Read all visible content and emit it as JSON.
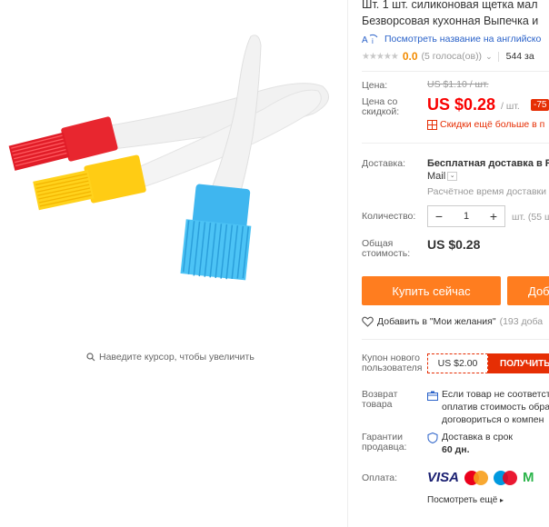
{
  "gallery": {
    "zoom_hint": "Наведите курсор, чтобы увеличить"
  },
  "product": {
    "title_line1": "Шт. 1 шт. силиконовая щетка мал",
    "title_line2": "Безворсовая кухонная Выпечка и",
    "translate_link": "Посмотреть название на английско",
    "rating_value": "0.0",
    "votes": "(5 голоса(ов))",
    "orders": "544 за"
  },
  "price": {
    "label_price": "Цена:",
    "old_price": "US $1.10 / шт.",
    "label_discount_line1": "Цена со",
    "label_discount_line2": "скидкой:",
    "sale_price": "US $0.28",
    "unit": "/ шт.",
    "discount_badge": "-75",
    "promo_text": "Скидки ещё больше в п"
  },
  "shipping": {
    "label": "Доставка:",
    "text_bold": "Бесплатная доставка в Ru",
    "method": "Mail",
    "estimate": "Расчётное время доставки"
  },
  "quantity": {
    "label": "Количество:",
    "value": "1",
    "minus": "−",
    "plus": "+",
    "available": "шт. (55 ш"
  },
  "total": {
    "label_line1": "Общая",
    "label_line2": "стоимость:",
    "value": "US $0.28"
  },
  "actions": {
    "buy_now": "Купить сейчас",
    "add_to_cart": "Доб"
  },
  "wishlist": {
    "label": "Добавить в \"Мои желания\"",
    "count": "(193 доба"
  },
  "coupon": {
    "label_line1": "Купон нового",
    "label_line2": "пользователя",
    "amount": "US $2.00",
    "get_label": "ПОЛУЧИТЬ"
  },
  "returns": {
    "label_line1": "Возврат",
    "label_line2": "товара",
    "line1": "Если товар не соответст",
    "line2": "оплатив стоимость обра",
    "line3": "договориться о компен"
  },
  "guarantee": {
    "label_line1": "Гарантии",
    "label_line2": "продавца:",
    "line1": "Доставка в срок",
    "line2": "60 дн."
  },
  "payment": {
    "label": "Оплата:",
    "visa": "VISA",
    "mcash": "M",
    "see_more": "Посмотреть ещё"
  },
  "colors": {
    "accent_orange": "#ff7d1f",
    "price_red": "#f90000",
    "link_blue": "#2a62c9"
  }
}
